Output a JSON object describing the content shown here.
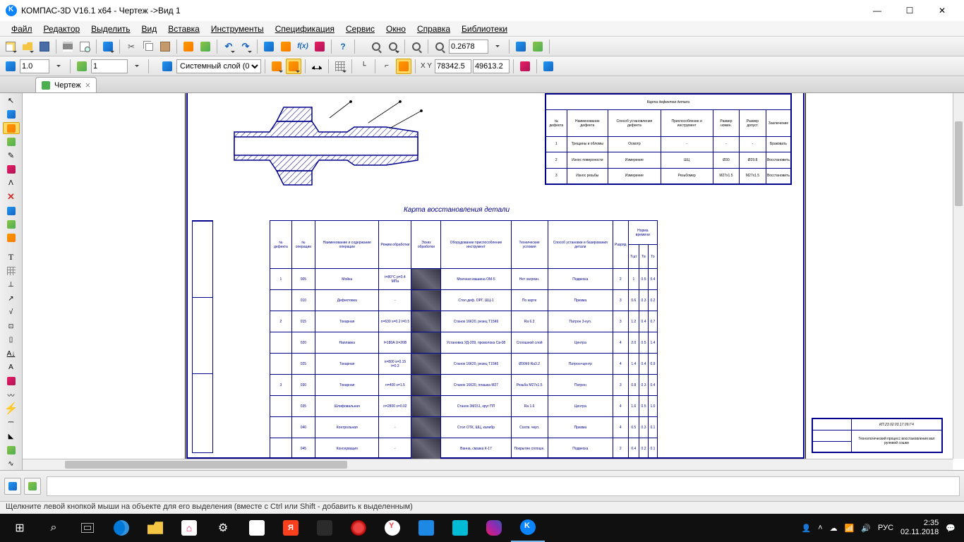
{
  "window": {
    "title": "КОМПАС-3D V16.1 x64 - Чертеж ->Вид 1"
  },
  "menu": {
    "file": "Файл",
    "editor": "Редактор",
    "select": "Выделить",
    "view": "Вид",
    "insert": "Вставка",
    "tools": "Инструменты",
    "spec": "Спецификация",
    "service": "Сервис",
    "window": "Окно",
    "help": "Справка",
    "libs": "Библиотеки"
  },
  "toolbar1": {
    "zoom_value": "0.2678"
  },
  "toolbar2": {
    "scale_value": "1.0",
    "view_number": "1",
    "layer": "Системный слой (0)",
    "coord_x": "78342.5",
    "coord_y": "49613.2"
  },
  "doctab": {
    "label": "Чертеж"
  },
  "drawing": {
    "title": "Карта восстановления детали",
    "top_table_title": "Карта дефектов детали",
    "top_table_headers": [
      "№ дефекта",
      "Наименование дефекта",
      "Способ установления дефекта",
      "Приспособление и инструмент",
      "Размер номин.",
      "Размер допуст.",
      "Заключение"
    ],
    "top_table_rows": [
      [
        "1",
        "Трещины и обломы",
        "Осмотр",
        "-",
        "-",
        "-",
        "Браковать"
      ],
      [
        "2",
        "Износ поверхности",
        "Измерение",
        "ШЦ",
        "Ø30",
        "Ø29.8",
        "Восстановить"
      ],
      [
        "3",
        "Износ резьбы",
        "Измерение",
        "Резьбомер",
        "М27х1.5",
        "М27х1.5",
        "Восстановить"
      ]
    ],
    "main_headers": [
      "№ дефекта",
      "№ операции",
      "Наименование и содержание операции",
      "Режим обработки",
      "Эскиз обработки",
      "Оборудование приспособление инструмент",
      "Технические условия",
      "Способ установки и базирования детали",
      "Разряд",
      "Тшт",
      "Тв",
      "То"
    ],
    "main_rows": [
      [
        "1",
        "005",
        "Мойка",
        "t=80°C p=0.4 МПа",
        "",
        "Моечная машина ОМ-5",
        "Нет загрязн.",
        "Подвеска",
        "2",
        "1",
        "0.5",
        "0.4"
      ],
      [
        "",
        "010",
        "Дефектовка",
        "-",
        "",
        "Стол деф. ОРГ, ШЦ-1",
        "По картe",
        "Призма",
        "3",
        "0.6",
        "0.3",
        "0.2"
      ],
      [
        "2",
        "015",
        "Токарная",
        "n=630 s=0.2 t=0.5",
        "",
        "Станок 16К20, резец Т15К6",
        "Ra 6.3",
        "Патрон 3-кул.",
        "3",
        "1.2",
        "0.4",
        "0.7"
      ],
      [
        "",
        "020",
        "Наплавка",
        "I=180A U=26B",
        "",
        "Установка УД-209, проволока Св-08",
        "Сплошной слой",
        "Центра",
        "4",
        "2.0",
        "0.5",
        "1.4"
      ],
      [
        "",
        "025",
        "Токарная",
        "n=800 s=0.15 t=0.3",
        "",
        "Станок 16К20, резец Т15К6",
        "Ø30h9 Ra3.2",
        "Патрон+центр",
        "4",
        "1.4",
        "0.4",
        "0.9"
      ],
      [
        "3",
        "030",
        "Токарная",
        "n=400 s=1.5",
        "",
        "Станок 16К20, плашка М27",
        "Резьба М27х1.5",
        "Патрон",
        "3",
        "0.8",
        "0.3",
        "0.4"
      ],
      [
        "",
        "035",
        "Шлифовальная",
        "n=2800 s=0.02",
        "",
        "Станок 3М151, круг ПП",
        "Ra 1.6",
        "Центра",
        "4",
        "1.6",
        "0.5",
        "1.0"
      ],
      [
        "",
        "040",
        "Контрольная",
        "-",
        "",
        "Стол ОТК, ШЦ, калибр",
        "Соотв. черт.",
        "Призма",
        "4",
        "0.5",
        "0.3",
        "0.1"
      ],
      [
        "",
        "045",
        "Консервация",
        "-",
        "",
        "Ванна, смазка К-17",
        "Покрытие сплошн.",
        "Подвеска",
        "2",
        "0.4",
        "0.2",
        "0.1"
      ]
    ],
    "stamp_code": "КП.23.02.03.17.09.ГЧ",
    "stamp_title": "Технологический процесс восстановления вал рулевой сошки"
  },
  "status": {
    "hint": "Щелкните левой кнопкой мыши на объекте для его выделения (вместе с Ctrl или Shift - добавить к выделенным)"
  },
  "taskbar": {
    "lang": "РУС",
    "time": "2:35",
    "date": "02.11.2018"
  }
}
